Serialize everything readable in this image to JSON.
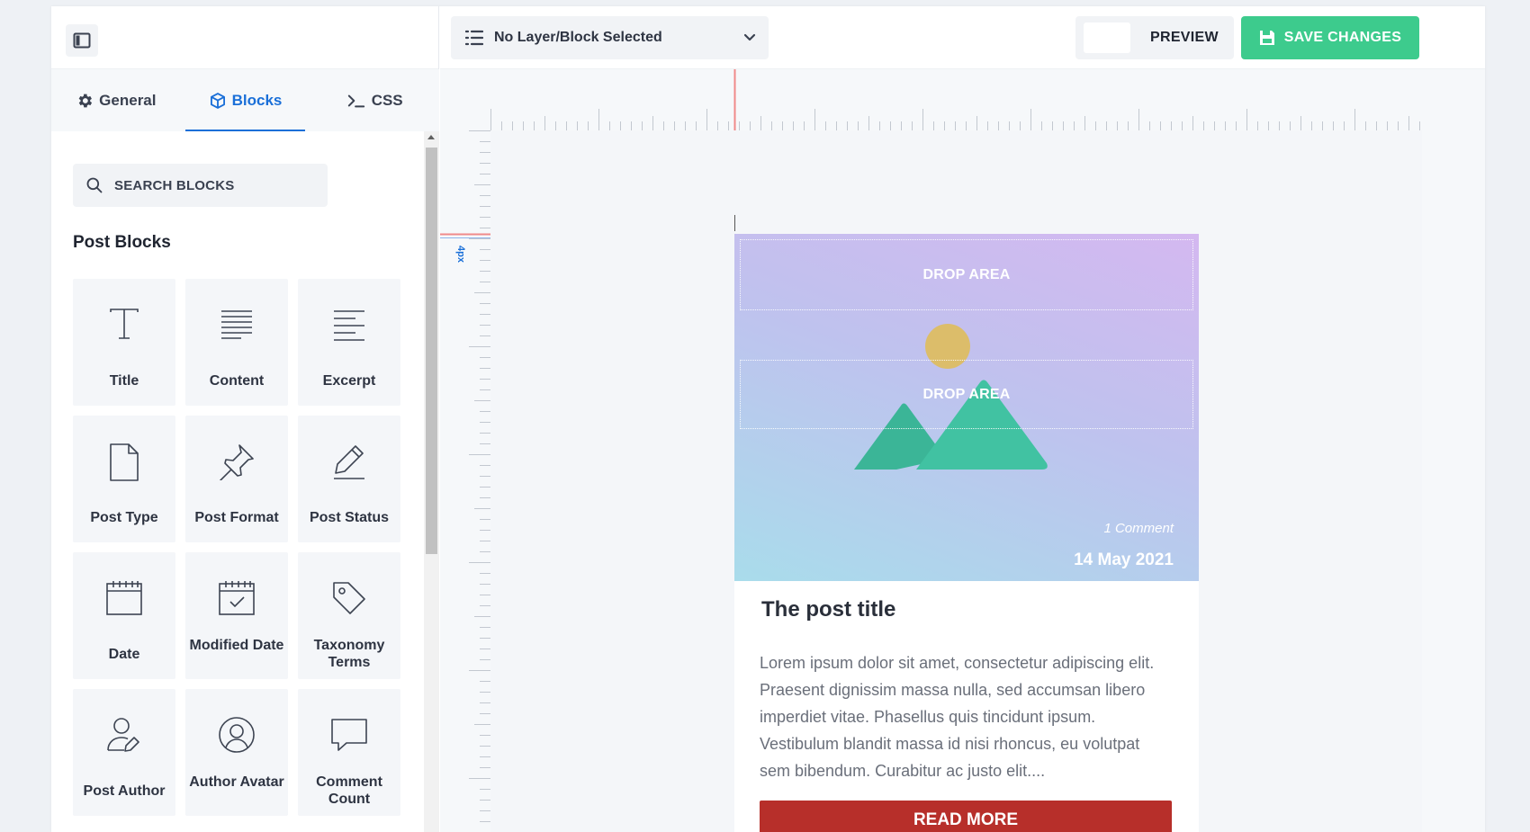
{
  "sidebar": {
    "toggle_icon": "sidebar-panel-icon",
    "tabs": [
      {
        "label": "General",
        "icon": "gear-icon",
        "active": false
      },
      {
        "label": "Blocks",
        "icon": "cube-icon",
        "active": true
      },
      {
        "label": "CSS",
        "icon": "terminal-icon",
        "active": false
      }
    ],
    "search": {
      "placeholder": "SEARCH BLOCKS"
    },
    "section_title": "Post Blocks",
    "blocks": [
      {
        "label": "Title",
        "icon": "text-t-icon"
      },
      {
        "label": "Content",
        "icon": "align-justify-icon"
      },
      {
        "label": "Excerpt",
        "icon": "align-left-icon"
      },
      {
        "label": "Post Type",
        "icon": "file-icon"
      },
      {
        "label": "Post Format",
        "icon": "pin-icon"
      },
      {
        "label": "Post Status",
        "icon": "pencil-icon"
      },
      {
        "label": "Date",
        "icon": "calendar-icon"
      },
      {
        "label": "Modified Date",
        "icon": "calendar-check-icon"
      },
      {
        "label": "Taxonomy Terms",
        "icon": "tag-icon"
      },
      {
        "label": "Post Author",
        "icon": "user-edit-icon"
      },
      {
        "label": "Author Avatar",
        "icon": "user-circle-icon"
      },
      {
        "label": "Comment Count",
        "icon": "comment-icon"
      }
    ]
  },
  "topbar": {
    "layer_select": {
      "value": "No Layer/Block Selected",
      "icon": "list-icon"
    },
    "preview_label": "PREVIEW",
    "save_label": "SAVE CHANGES",
    "save_icon": "floppy-disk-icon"
  },
  "canvas": {
    "ruler_margin_label": "4px",
    "card": {
      "drop_area_1": "DROP AREA",
      "drop_area_2": "DROP AREA",
      "comment": "1 Comment",
      "date": "14 May 2021",
      "title": "The post title",
      "excerpt": "Lorem ipsum dolor sit amet, consectetur adipiscing elit. Praesent dignissim massa nulla, sed accumsan libero imperdiet vitae. Phasellus quis tincidunt ipsum. Vestibulum blandit massa id nisi rhoncus, eu volutpat sem bibendum. Curabitur ac justo elit....",
      "read_more": "READ MORE"
    }
  },
  "colors": {
    "accent": "#1a6fd8",
    "save": "#3dcb8d",
    "read_more": "#b72f2a",
    "ruler_marker": "#f08a8a"
  }
}
